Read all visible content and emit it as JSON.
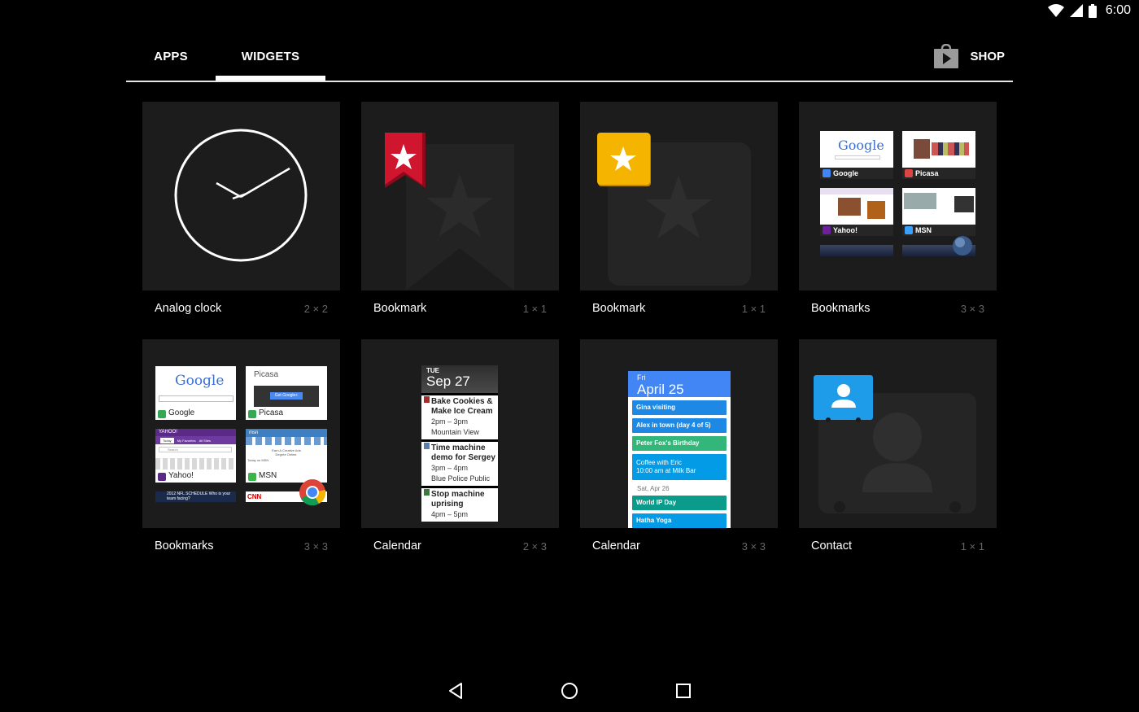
{
  "status_bar": {
    "time": "6:00"
  },
  "tabs": [
    {
      "label": "APPS",
      "selected": false
    },
    {
      "label": "WIDGETS",
      "selected": true
    }
  ],
  "shop": {
    "label": "SHOP",
    "icon": "play-store-bag-icon"
  },
  "widgets": [
    {
      "name": "Analog clock",
      "size": "2 × 2",
      "preview": "analog-clock"
    },
    {
      "name": "Bookmark",
      "size": "1 × 1",
      "preview": "red-bookmark-ribbon"
    },
    {
      "name": "Bookmark",
      "size": "1 × 1",
      "preview": "yellow-bookmark-star"
    },
    {
      "name": "Bookmarks",
      "size": "3 × 3",
      "preview": "bookmark-thumbnails"
    },
    {
      "name": "Bookmarks",
      "size": "3 × 3",
      "preview": "bookmark-thumbnails-light"
    },
    {
      "name": "Calendar",
      "size": "2 × 3",
      "preview": "calendar-agenda-dark"
    },
    {
      "name": "Calendar",
      "size": "3 × 3",
      "preview": "calendar-agenda-blue"
    },
    {
      "name": "Contact",
      "size": "1 × 1",
      "preview": "contact-card"
    }
  ],
  "bookmark_thumbs_dark": [
    {
      "label": "Google",
      "logo": "Google"
    },
    {
      "label": "Picasa"
    },
    {
      "label": "Yahoo!"
    },
    {
      "label": "MSN"
    }
  ],
  "bookmark_thumbs_light": [
    {
      "label": "Google",
      "logo": "Google"
    },
    {
      "label": "Picasa",
      "logo": "Picasa",
      "button": "Get Google+"
    },
    {
      "label": "Yahoo!",
      "header": "YAHOO!",
      "tabs": [
        "Today",
        "My Favorites",
        "All Sites"
      ],
      "search": "Search"
    },
    {
      "label": "MSN",
      "header": "msn",
      "promo": "Earn A Creative Arts Degree Online.",
      "sub": "Today on MSN"
    }
  ],
  "bookmark_thumbs_bottom": [
    {
      "text": "2012 NFL SCHEDULE Who is your team facing?"
    },
    {
      "text": "CNN"
    }
  ],
  "calendar_2x3": {
    "day": "TUE",
    "date": "Sep 27",
    "events": [
      {
        "title1": "Bake Cookies &",
        "title2": "Make Ice Cream",
        "time": "2pm – 3pm",
        "location": "Mountain View",
        "color": "#a52a2a"
      },
      {
        "title1": "Time machine",
        "title2": "demo for Sergey",
        "time": "3pm – 4pm",
        "location": "Blue Police Public",
        "color": "#5a7fa8"
      },
      {
        "title1": "Stop machine",
        "title2": "uprising",
        "time": "4pm – 5pm",
        "location": "",
        "color": "#3c7a3c"
      }
    ]
  },
  "calendar_3x3": {
    "day": "Fri",
    "date": "April 25",
    "events": [
      {
        "title": "Gina visiting",
        "color": "#1e88e5"
      },
      {
        "title": "Alex in town (day 4 of 5)",
        "color": "#1e88e5"
      },
      {
        "title": "Peter Fox's Birthday",
        "color": "#33b679"
      },
      {
        "title": "Coffee with Eric",
        "subtitle": "10:00 am at Milk Bar",
        "color": "#039be5"
      }
    ],
    "next_day": "Sat, Apr 26",
    "next_events": [
      {
        "title": "World IP Day",
        "color": "#0b9b8a"
      },
      {
        "title": "Hatha Yoga",
        "color": "#039be5"
      }
    ]
  },
  "colors": {
    "background": "#000000",
    "tile": "#1c1c1c",
    "bookmark_red": "#c8102e",
    "bookmark_yellow": "#f4b400",
    "contact_blue": "#1e9be9",
    "calendar_blue": "#4285f4"
  }
}
